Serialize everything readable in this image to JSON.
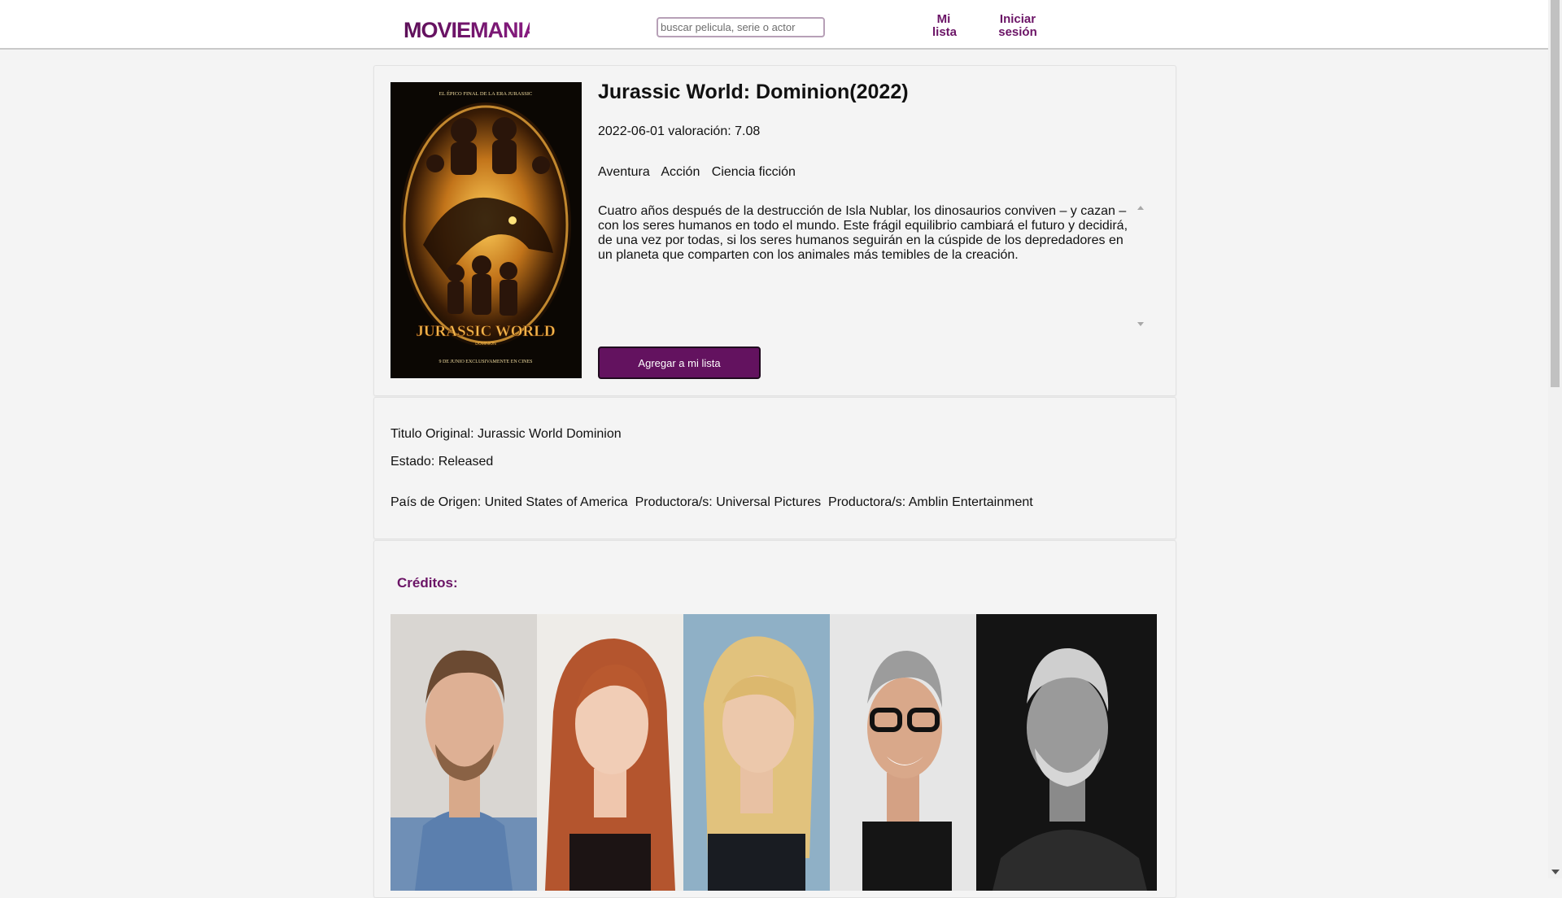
{
  "header": {
    "logo_text": "MOVIEMANIA",
    "search_placeholder": "buscar pelicula, serie o actor",
    "nav": {
      "my_list": "Mi lista",
      "login": "Iniciar sesión"
    }
  },
  "movie": {
    "title": "Jurassic World: Dominion(2022)",
    "meta": "2022-06-01 valoración: 7.08",
    "release_date": "2022-06-01",
    "rating": "7.08",
    "genres": [
      "Aventura",
      "Acción",
      "Ciencia ficción"
    ],
    "overview": "Cuatro años después de la destrucción de Isla Nublar, los dinosaurios conviven – y cazan – con los seres humanos en todo el mundo. Este frágil equilibrio cambiará el futuro y decidirá, de una vez por todas, si los seres humanos seguirán en la cúspide de los depredadores en un planeta que comparten con los animales más temibles de la creación.",
    "add_button": "Agregar a mi lista",
    "poster": {
      "tagline": "EL ÉPICO FINAL DE LA ERA JURASSIC",
      "logo": "JURASSIC WORLD",
      "sub": "DOMINION",
      "footer": "9 DE JUNIO EXCLUSIVAMENTE EN CINES"
    }
  },
  "details": {
    "original_title": "Titulo Original: Jurassic World Dominion",
    "status": "Estado: Released",
    "origin_line": "País de Origen: United States of America  Productora/s: Universal Pictures  Productora/s: Amblin Entertainment"
  },
  "credits": {
    "title": "Créditos:",
    "cast_count": 5
  },
  "colors": {
    "brand": "#63125f",
    "nav_text": "#6b1466",
    "background": "#f4f4f4"
  }
}
